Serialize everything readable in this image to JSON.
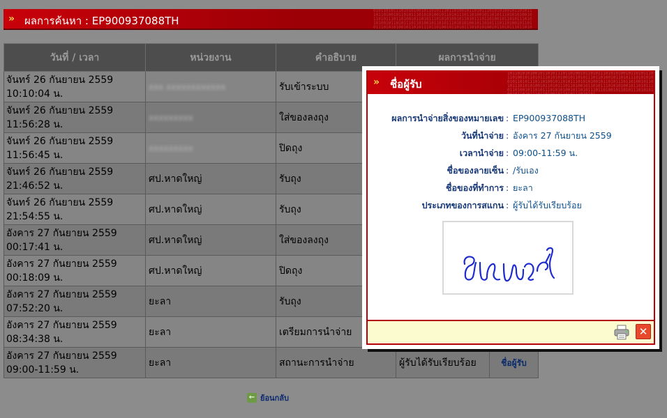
{
  "header": {
    "arrows": "»",
    "title": "ผลการค้นหา : EP900937088TH"
  },
  "table": {
    "columns": [
      "วันที่ / เวลา",
      "หน่วยงาน",
      "คำอธิบาย",
      "ผลการนำจ่าย"
    ],
    "rows": [
      {
        "date": "จันทร์ 26 กันยายน 2559",
        "time": "10:10:04 น.",
        "unit": "xxx xxxxxxxxxxxx",
        "desc": "รับเข้าระบบ",
        "result": "",
        "link": ""
      },
      {
        "date": "จันทร์ 26 กันยายน 2559",
        "time": "11:56:28 น.",
        "unit": "xxxxxxxxx",
        "desc": "ใส่ของลงถุง",
        "result": "",
        "link": ""
      },
      {
        "date": "จันทร์ 26 กันยายน 2559",
        "time": "11:56:45 น.",
        "unit": "xxxxxxxxx",
        "desc": "ปิดถุง",
        "result": "",
        "link": ""
      },
      {
        "date": "จันทร์ 26 กันยายน 2559",
        "time": "21:46:52 น.",
        "unit": "ศป.หาดใหญ่",
        "desc": "รับถุง",
        "result": "",
        "link": ""
      },
      {
        "date": "จันทร์ 26 กันยายน 2559",
        "time": "21:54:55 น.",
        "unit": "ศป.หาดใหญ่",
        "desc": "รับถุง",
        "result": "",
        "link": ""
      },
      {
        "date": "อังคาร 27 กันยายน 2559",
        "time": "00:17:41 น.",
        "unit": "ศป.หาดใหญ่",
        "desc": "ใส่ของลงถุง",
        "result": "",
        "link": ""
      },
      {
        "date": "อังคาร 27 กันยายน 2559",
        "time": "00:18:09 น.",
        "unit": "ศป.หาดใหญ่",
        "desc": "ปิดถุง",
        "result": "",
        "link": ""
      },
      {
        "date": "อังคาร 27 กันยายน 2559",
        "time": "07:52:20 น.",
        "unit": "ยะลา",
        "desc": "รับถุง",
        "result": "",
        "link": ""
      },
      {
        "date": "อังคาร 27 กันยายน 2559",
        "time": "08:34:38 น.",
        "unit": "ยะลา",
        "desc": "เตรียมการนำจ่าย",
        "result": "",
        "link": ""
      },
      {
        "date": "อังคาร 27 กันยายน 2559",
        "time": "09:00-11:59 น.",
        "unit": "ยะลา",
        "desc": "สถานะการนำจ่าย",
        "result": "ผู้รับได้รับเรียบร้อย",
        "link": "ชื่อผู้รับ"
      }
    ]
  },
  "back": {
    "label": "ย้อนกลับ"
  },
  "modal": {
    "arrows": "»",
    "title": "ชื่อผู้รับ",
    "fields": [
      {
        "label": "ผลการนำจ่ายสิ่งของหมายเลข",
        "value": "EP900937088TH"
      },
      {
        "label": "วันที่นำจ่าย",
        "value": "อังคาร 27 กันยายน 2559"
      },
      {
        "label": "เวลานำจ่าย",
        "value": "09:00-11:59 น."
      },
      {
        "label": "ชื่อของลายเซ็น",
        "value": "/รับเอง"
      },
      {
        "label": "ชื่อของที่ทำการ",
        "value": "ยะลา"
      },
      {
        "label": "ประเภทของการสแกน",
        "value": "ผู้รับได้รับเรียบร้อย"
      }
    ],
    "print_icon": "printer-icon",
    "close_icon": "close-icon",
    "close_glyph": "✕"
  },
  "colors": {
    "header_red": "#c8010a",
    "modal_footer": "#fcfbd0",
    "label_blue": "#1a3a78",
    "signature_ink": "#1d2bd0"
  }
}
